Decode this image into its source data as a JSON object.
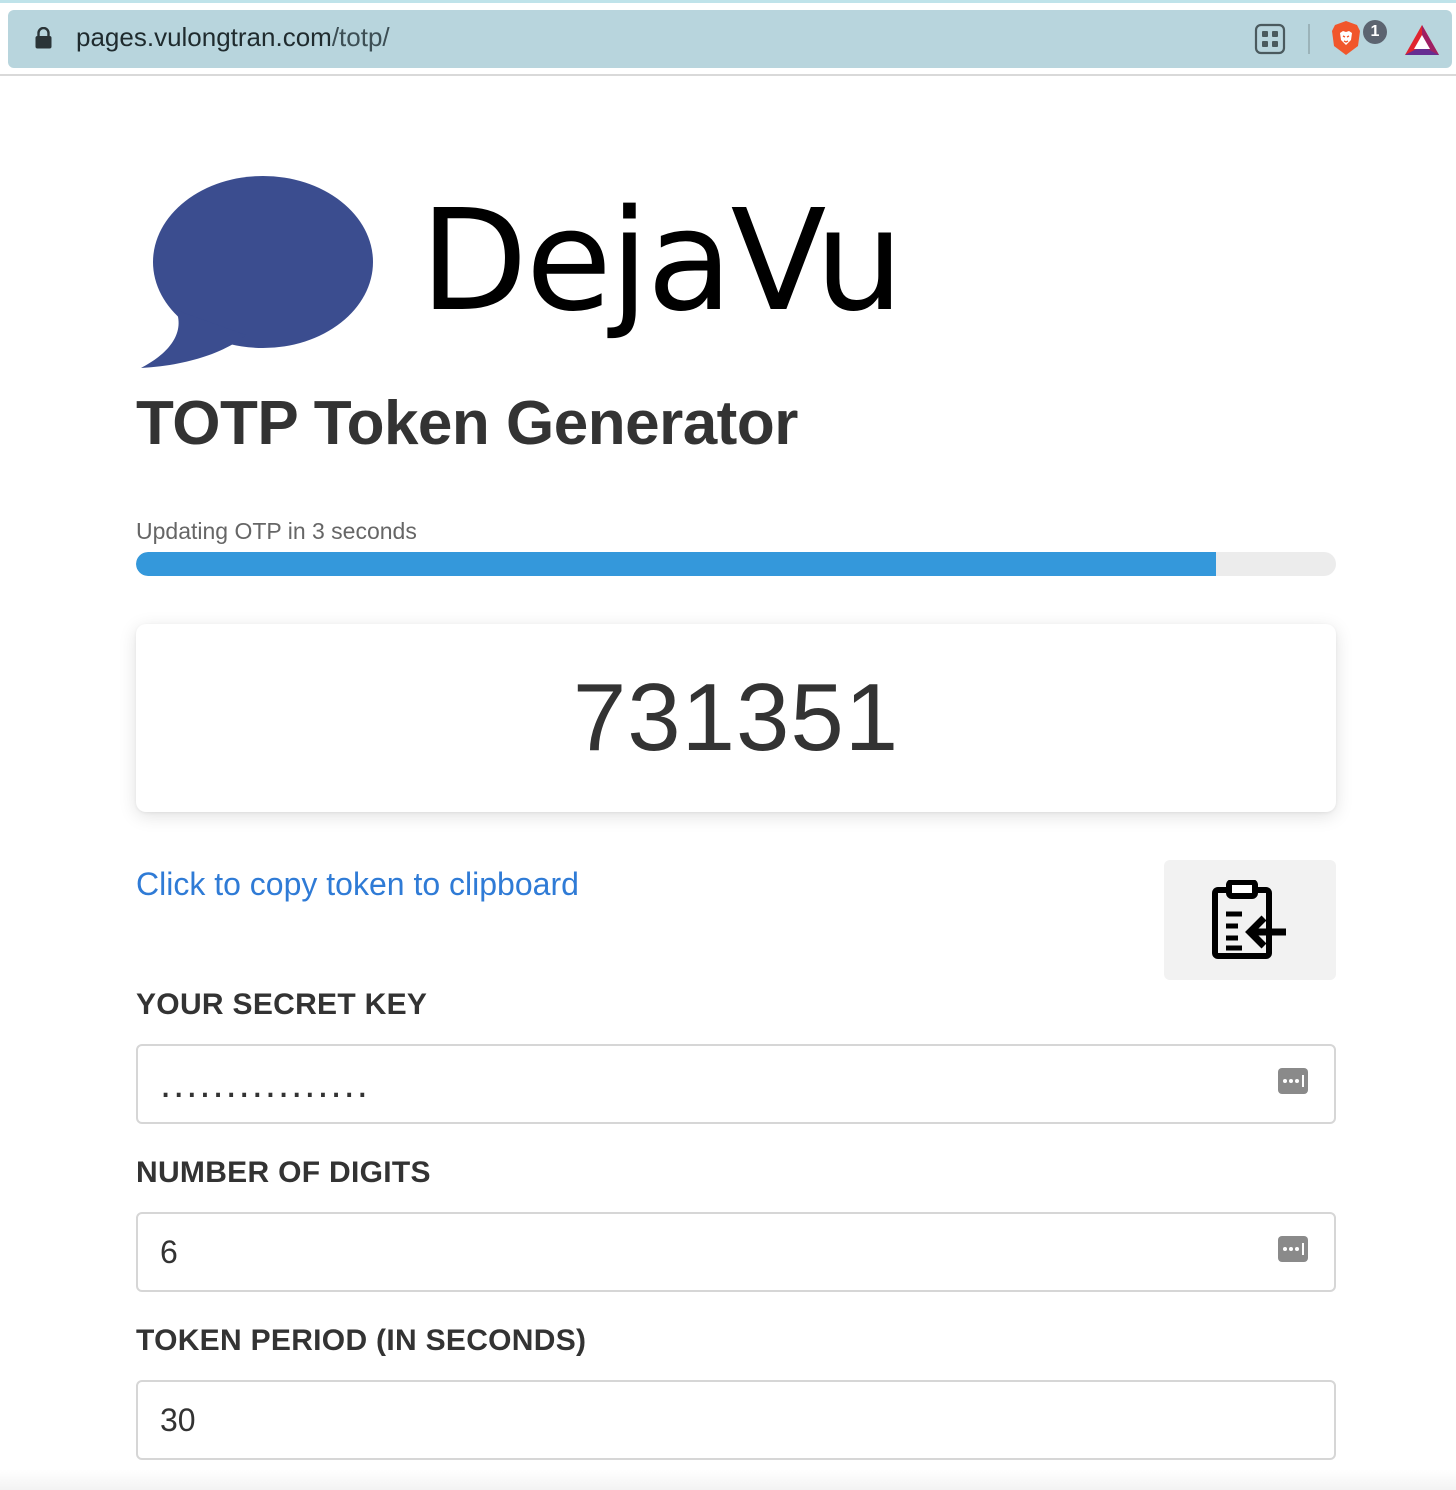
{
  "browser": {
    "url_host": "pages.vulongtran.com",
    "url_path": "/totp/",
    "shield_count": "1"
  },
  "header": {
    "logo_text": "DejaVu",
    "title": "TOTP Token Generator"
  },
  "timer": {
    "status_text": "Updating OTP in 3 seconds",
    "progress_fraction": 0.9,
    "progress_color": "#3498db"
  },
  "token": {
    "value": "731351"
  },
  "copy": {
    "link_text": "Click to copy token to clipboard",
    "button_icon": "clipboard-copy-icon"
  },
  "form": {
    "secret_label": "YOUR SECRET KEY",
    "secret_value": "................",
    "digits_label": "NUMBER OF DIGITS",
    "digits_value": "6",
    "period_label": "TOKEN PERIOD (IN SECONDS)",
    "period_value": "30"
  },
  "colors": {
    "brand_bubble": "#3b4d8f",
    "link": "#2f7bd6"
  }
}
